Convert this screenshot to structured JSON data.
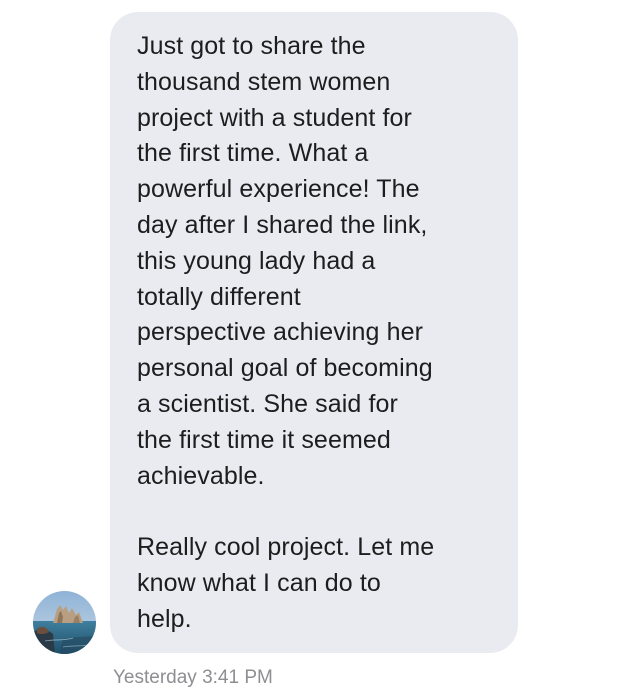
{
  "message": {
    "paragraphs": [
      {
        "lines": [
          "Just got to share the",
          "thousand stem women",
          "project with a student for",
          "the first time. What a",
          "powerful experience! The",
          "day after I shared the link,",
          "this young lady had a",
          "totally different",
          "perspective achieving her",
          "personal goal of becoming",
          "a scientist. She said for",
          "the first time it seemed",
          "achievable."
        ]
      },
      {
        "lines": [
          "Really cool project. Let me",
          "know what I can do to",
          "help."
        ]
      }
    ]
  },
  "timestamp": "Yesterday 3:41 PM",
  "colors": {
    "bubble": "#e9ebf0",
    "text": "#1d1d1f",
    "timestamp": "#8e8e93"
  },
  "avatar": {
    "icon": "sender-avatar-photo"
  }
}
